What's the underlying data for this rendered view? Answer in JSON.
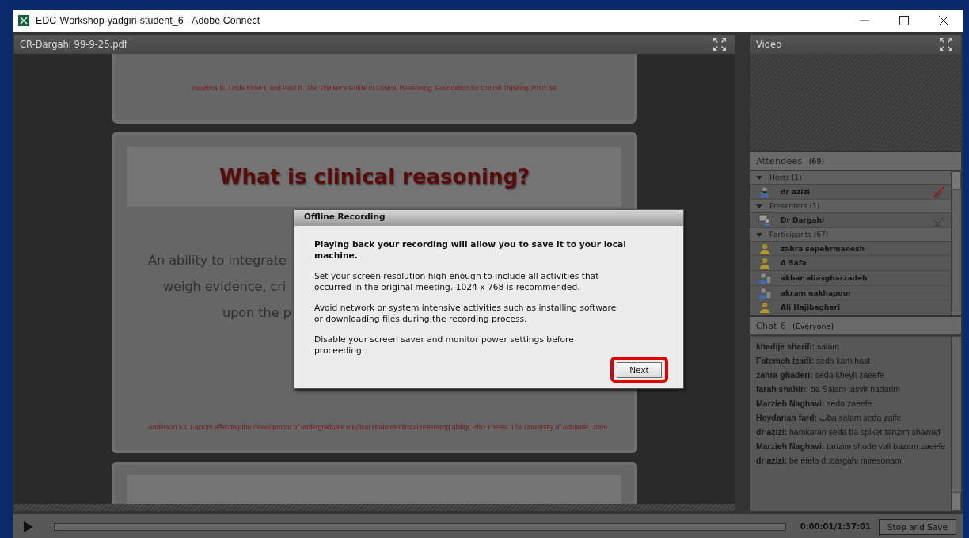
{
  "window": {
    "title": "EDC-Workshop-yadgiri-student_6 - Adobe Connect"
  },
  "document_pod": {
    "title": "CR-Dargahi 99-9-25.pdf",
    "slides": [
      {
        "kind": "citation",
        "citation": "Hawkins D, Linda Elder  L and Paul R. The Thinker's Guide to Clinical Reasoning, Foundation for Critical Thinking 2010; 58"
      },
      {
        "kind": "content",
        "heading": "What is clinical reasoning?",
        "lines": [
          "An ability to integrate",
          "weigh evidence, cri",
          "upon the p"
        ],
        "citation": "Anderson KJ. Factors affecting the development of undergraduate medical students'clinical reasoning ability. PhD Thesis. The University of Adelaide, 2006"
      },
      {
        "kind": "blank"
      }
    ]
  },
  "video_pod": {
    "title": "Video"
  },
  "attendees_pod": {
    "title": "Attendees",
    "count": "(69)",
    "groups": [
      {
        "label": "Hosts (1)",
        "expanded": true,
        "people": [
          {
            "name": "dr azizi",
            "kind": "host",
            "mic_muted": true
          }
        ]
      },
      {
        "label": "Presenters (1)",
        "expanded": true,
        "people": [
          {
            "name": "Dr Dargahi",
            "kind": "presenter",
            "mic_muted": false
          }
        ]
      },
      {
        "label": "Participants (67)",
        "expanded": true,
        "people": [
          {
            "name": "zahra  sepehrmanesh",
            "kind": "participant"
          },
          {
            "name": "A Safa",
            "kind": "participant"
          },
          {
            "name": "akbar aliasgharzadeh",
            "kind": "mobile"
          },
          {
            "name": "akram nakhapour",
            "kind": "mobile"
          },
          {
            "name": "Ali Hajibagheri",
            "kind": "participant"
          }
        ]
      }
    ]
  },
  "chat_pod": {
    "title": "Chat 6",
    "scope": "(Everyone)",
    "messages": [
      {
        "sender": "khadije sharifi:",
        "text": "salam"
      },
      {
        "sender": "Fatemeh izadi:",
        "text": "seda kam hast"
      },
      {
        "sender": "zahra ghaderi:",
        "text": "seda kheyli zaeefe"
      },
      {
        "sender": "farah shahin:",
        "text": "ba Salam tasvir nadarim"
      },
      {
        "sender": "Marzieh  Naghavi:",
        "text": "seda zaeefe"
      },
      {
        "sender": "Heydarian fard:",
        "text": "بba salam seda zaife"
      },
      {
        "sender": "dr azizi:",
        "text": "hamkaran seda ba spiker tanzim shawad"
      },
      {
        "sender": "Marzieh  Naghavi:",
        "text": "tanzim shode vali bazam zaeefe"
      },
      {
        "sender": "dr azizi:",
        "text": "be etela dr.dargahi miresonam"
      }
    ]
  },
  "dialog": {
    "title": "Offline Recording",
    "paragraphs": [
      {
        "kind": "bold",
        "text": "Playing back your recording will allow you to save it to your local machine."
      },
      {
        "kind": "plain",
        "text": "Set your screen resolution high enough to include all activities that occurred in the original meeting. 1024 x 768 is recommended."
      },
      {
        "kind": "plain",
        "text": "Avoid network or system intensive activities such as installing software or downloading files during the recording process."
      },
      {
        "kind": "plain",
        "text": "Disable your screen saver and monitor power settings before proceeding."
      }
    ],
    "button": {
      "label": "Next",
      "highlighted": true
    }
  },
  "playback_bar": {
    "level": 0.0002,
    "time": "0:00:01/1:37:01",
    "button": "Stop and Save"
  }
}
